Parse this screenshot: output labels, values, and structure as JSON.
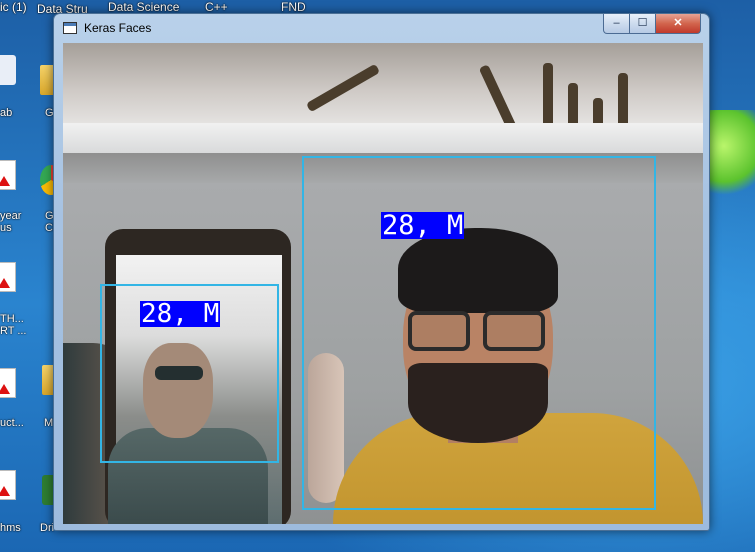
{
  "desktop": {
    "top_labels": [
      "ic (1)",
      "Data Stru",
      "Data Science",
      "C++",
      "FND"
    ],
    "icon_labels": [
      "ab",
      "Gi",
      "year us",
      "G Cl",
      "TH... RT ...",
      "uct...",
      "M",
      "hms",
      "Dri"
    ]
  },
  "window": {
    "title": "Keras Faces",
    "controls": {
      "minimize": "–",
      "maximize": "☐",
      "close": "✕"
    }
  },
  "detections": [
    {
      "label": "28, M"
    },
    {
      "label": "28, M"
    }
  ],
  "colors": {
    "box": "#33b5e5",
    "label_bg": "#0000ff",
    "label_text": "#ffffff"
  }
}
